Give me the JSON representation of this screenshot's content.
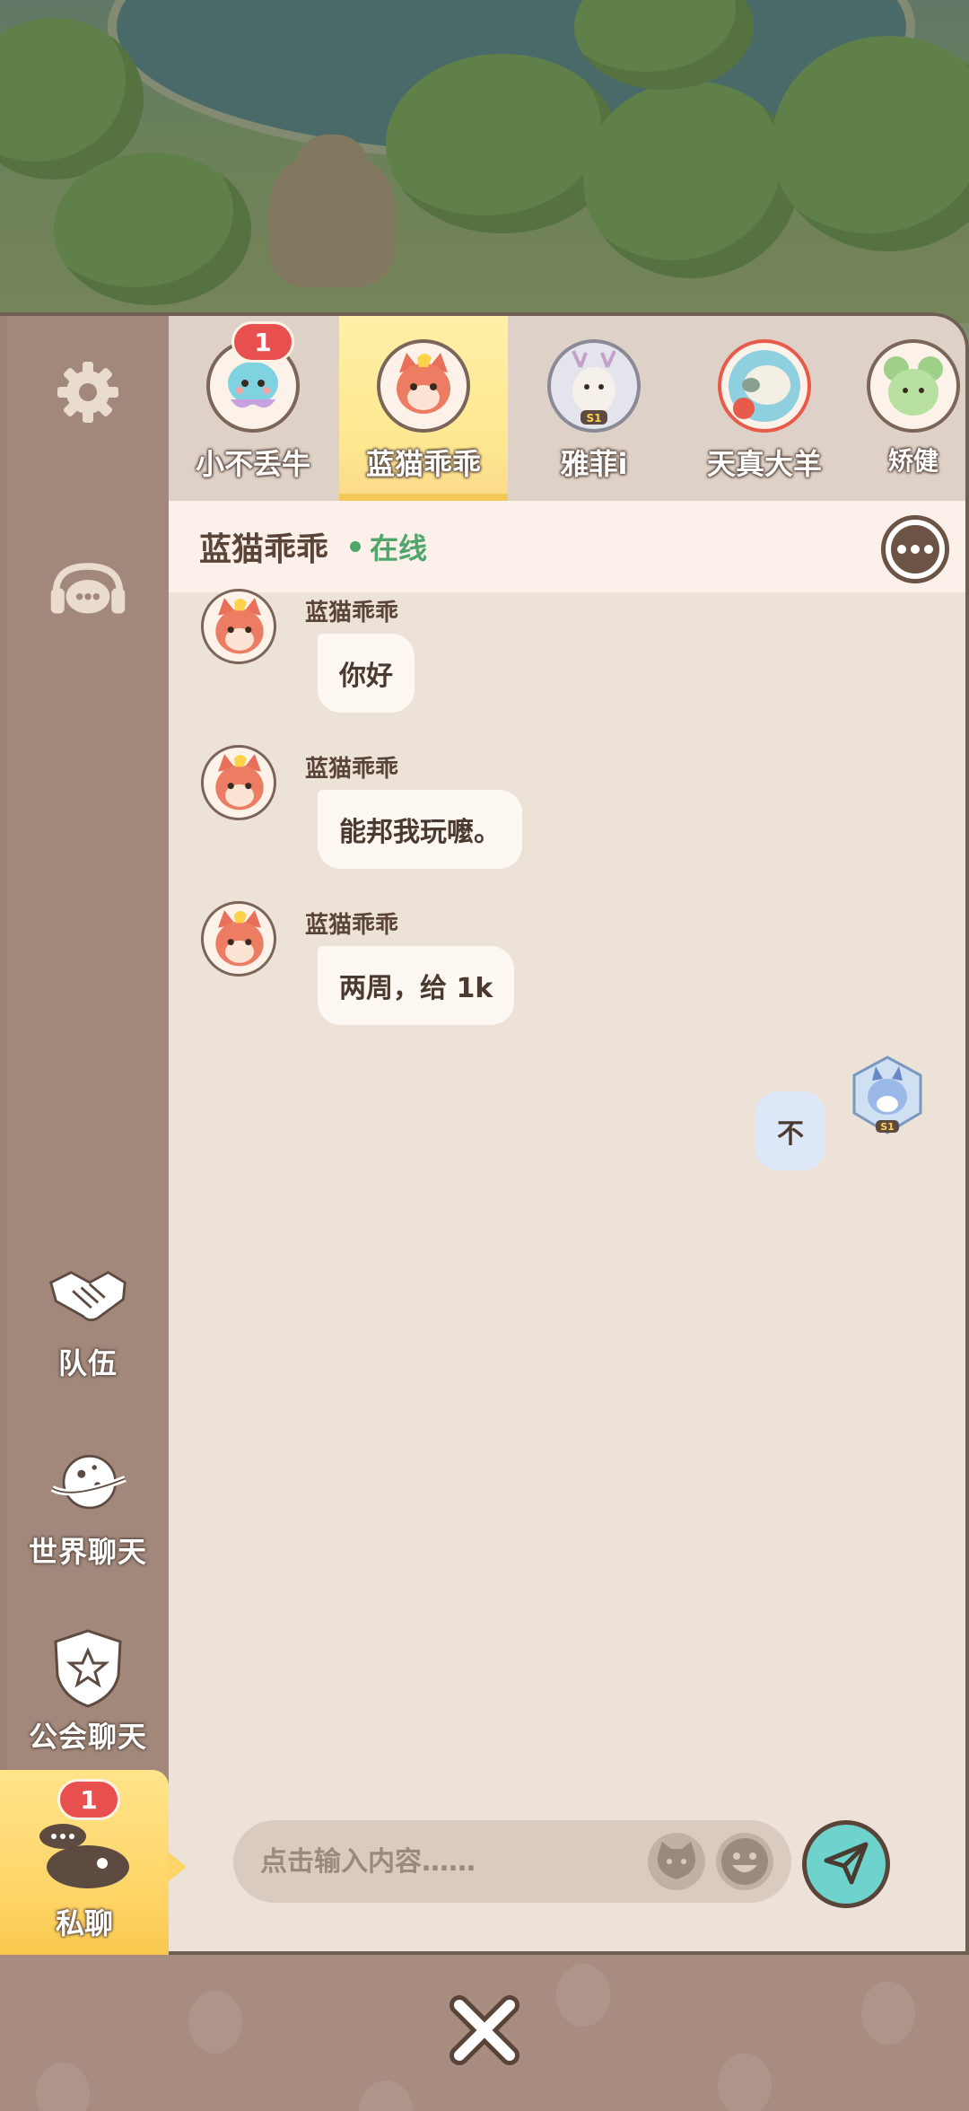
{
  "private_chat": {
    "contacts": [
      {
        "name": "小不丢牛",
        "badge": "1",
        "selected": false,
        "avatar_icon": "jellyfish-avatar-icon"
      },
      {
        "name": "蓝猫乖乖",
        "badge": null,
        "selected": true,
        "avatar_icon": "fox-avatar-icon"
      },
      {
        "name": "雅菲i",
        "badge": null,
        "selected": false,
        "avatar_icon": "deer-avatar-icon",
        "rank": "S1"
      },
      {
        "name": "天真大羊",
        "badge": null,
        "selected": false,
        "avatar_icon": "sheep-avatar-icon"
      },
      {
        "name": "矫健",
        "badge": null,
        "selected": false,
        "avatar_icon": "mouse-avatar-icon"
      }
    ],
    "header": {
      "title": "蓝猫乖乖",
      "status": "在线"
    },
    "messages": [
      {
        "sender": "蓝猫乖乖",
        "text": "你好",
        "side": "left"
      },
      {
        "sender": "蓝猫乖乖",
        "text": "能邦我玩嚒。",
        "side": "left"
      },
      {
        "sender": "蓝猫乖乖",
        "text": "两周，给 1k",
        "side": "left"
      },
      {
        "sender": "",
        "text": "不",
        "side": "right",
        "rank": "S1"
      }
    ],
    "input": {
      "placeholder": "点击输入内容……"
    }
  },
  "rail": {
    "settings_icon": "gear-icon",
    "service_icon": "chat-headset-icon",
    "team": {
      "label": "队伍",
      "icon": "handshake-icon"
    },
    "world": {
      "label": "世界聊天",
      "icon": "planet-icon"
    },
    "guild": {
      "label": "公会聊天",
      "icon": "shield-icon"
    },
    "private": {
      "label": "私聊",
      "icon": "speech-bubbles-icon",
      "badge": "1"
    }
  },
  "colors": {
    "panel_bg": "#ede2d8",
    "rail_bg": "#a2887b",
    "selected_tab": "#fde890",
    "online": "#4fa56a",
    "badge": "#e8504f",
    "send_button": "#6fd3cd"
  }
}
